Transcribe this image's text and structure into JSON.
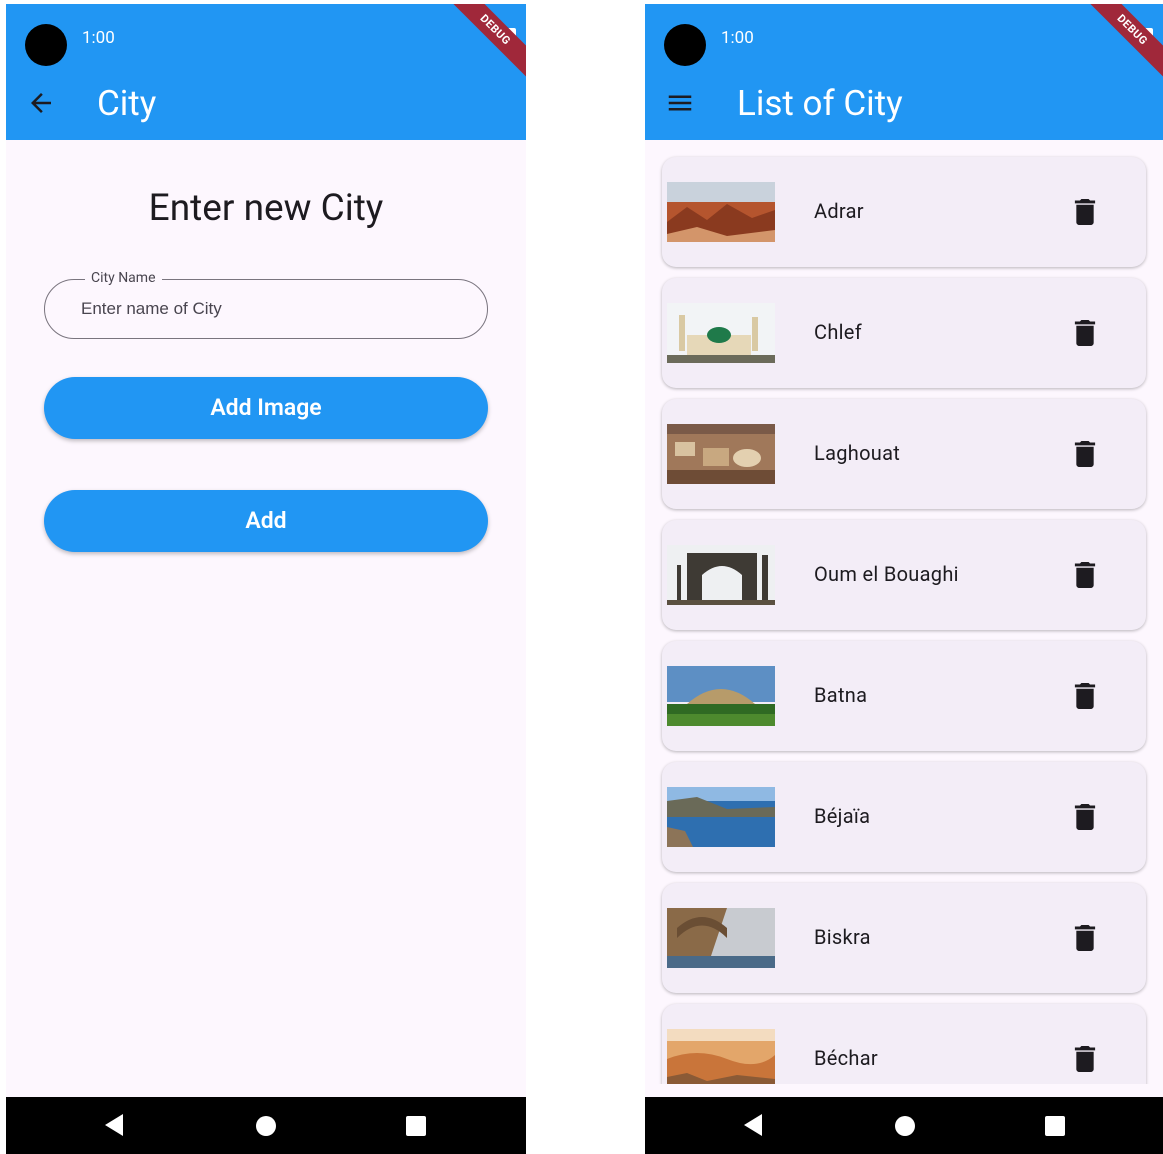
{
  "status_bar": {
    "time": "1:00",
    "debug_banner": "DEBUG"
  },
  "left_screen": {
    "appbar": {
      "title": "City",
      "leading_icon": "arrow-back-icon"
    },
    "heading": "Enter new City",
    "city_field": {
      "label": "City Name",
      "placeholder": "Enter name of City",
      "value": ""
    },
    "add_image_button": "Add Image",
    "add_button": "Add"
  },
  "right_screen": {
    "appbar": {
      "title": "List of City",
      "leading_icon": "menu-icon"
    },
    "cities": [
      {
        "name": "Adrar",
        "image": "desert-rocks"
      },
      {
        "name": "Chlef",
        "image": "mosque"
      },
      {
        "name": "Laghouat",
        "image": "town-aerial"
      },
      {
        "name": "Oum el Bouaghi",
        "image": "ruins-arch"
      },
      {
        "name": "Batna",
        "image": "tomb-field"
      },
      {
        "name": "Béjaïa",
        "image": "coast-water"
      },
      {
        "name": "Biskra",
        "image": "canyon-bridge"
      },
      {
        "name": "Béchar",
        "image": "dunes"
      }
    ],
    "delete_icon": "trash-icon"
  },
  "nav_bar": {
    "buttons": [
      "back",
      "home",
      "recents"
    ]
  },
  "colors": {
    "primary": "#2196f3",
    "background": "#fdf7fe",
    "card": "#f3edf7",
    "debug_banner": "#a0283a"
  }
}
